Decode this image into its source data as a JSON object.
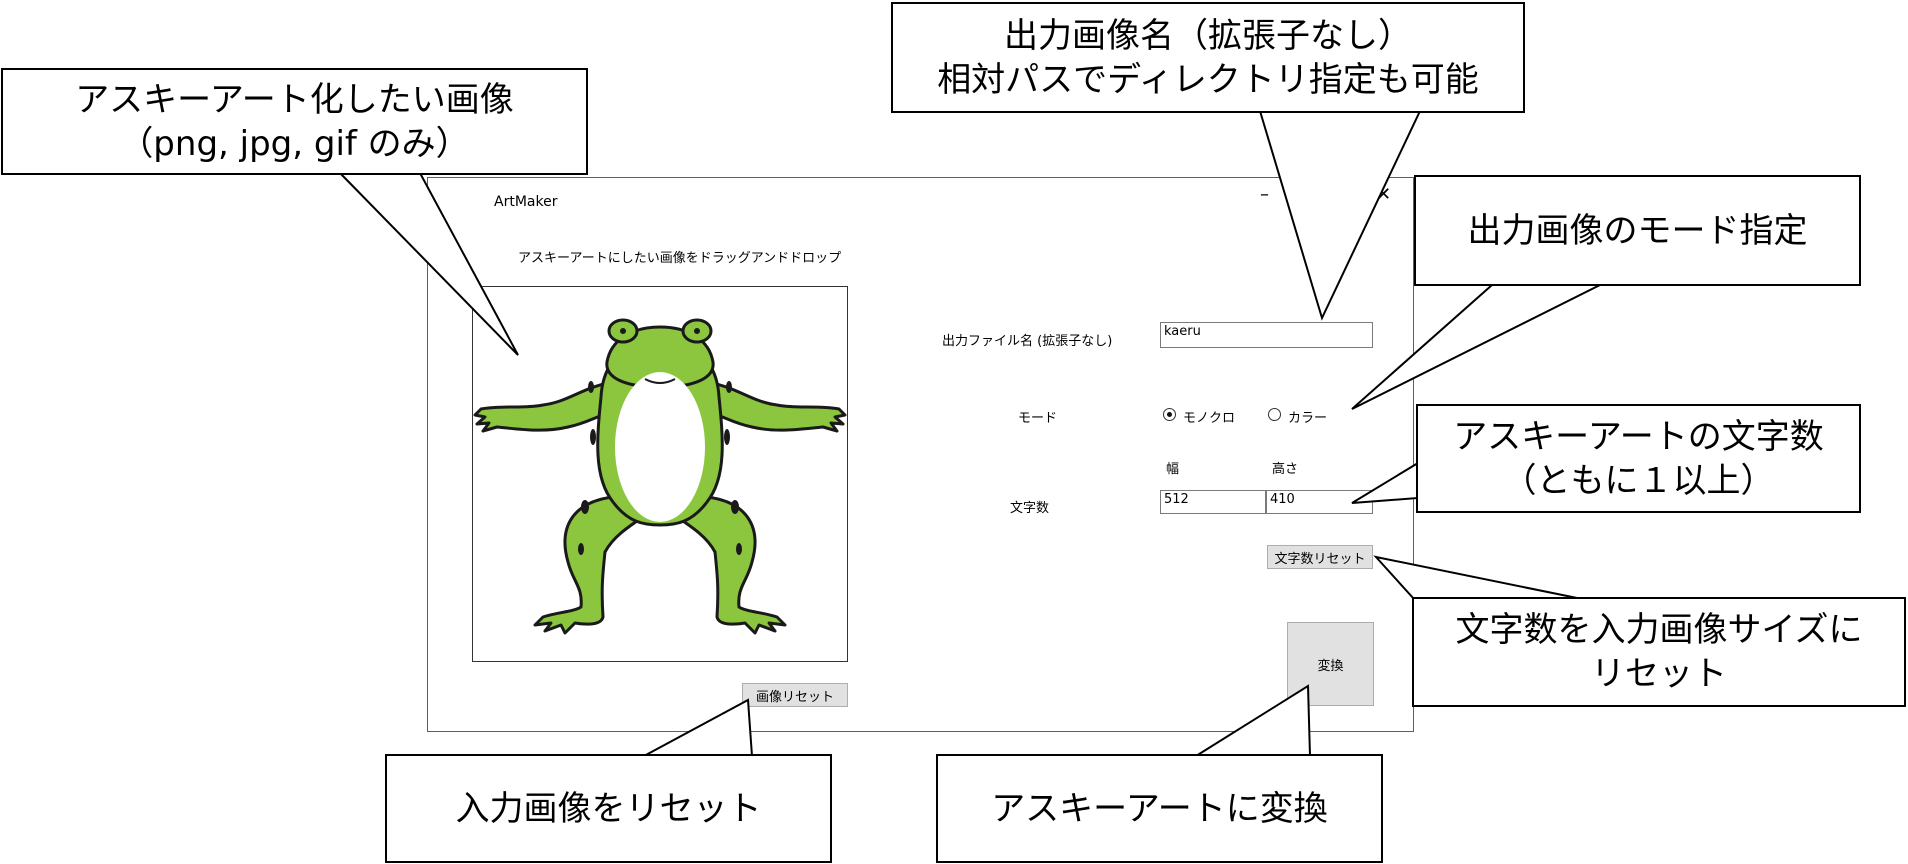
{
  "window": {
    "title": "ArtMaker",
    "minimize_glyph": "–",
    "close_glyph": "✕"
  },
  "dropzone": {
    "label": "アスキーアートにしたい画像をドラッグアンドドロップ"
  },
  "output": {
    "label": "出力ファイル名 (拡張子なし)",
    "value": "kaeru"
  },
  "mode": {
    "label": "モード",
    "options": [
      {
        "label": "モノクロ",
        "selected": true
      },
      {
        "label": "カラー",
        "selected": false
      }
    ]
  },
  "size": {
    "width_header": "幅",
    "height_header": "高さ",
    "label": "文字数",
    "width_value": "512",
    "height_value": "410",
    "reset_label": "文字数リセット"
  },
  "buttons": {
    "image_reset_label": "画像リセット",
    "convert_label": "変換"
  },
  "callouts": {
    "input_image": {
      "line1": "アスキーアート化したい画像",
      "line2": "（png, jpg, gif のみ）"
    },
    "output_name": {
      "line1": "出力画像名（拡張子なし）",
      "line2": "相対パスでディレクトリ指定も可能"
    },
    "mode": {
      "line1": "出力画像のモード指定"
    },
    "char_count": {
      "line1": "アスキーアートの文字数",
      "line2": "（ともに１以上）"
    },
    "char_reset": {
      "line1": "文字数を入力画像サイズに",
      "line2": "リセット"
    },
    "image_reset": {
      "line1": "入力画像をリセット"
    },
    "convert": {
      "line1": "アスキーアートに変換"
    }
  },
  "colors": {
    "window_border": "#1f6fb2",
    "frog_green": "#8cc63f",
    "frog_dark": "#1a1a1a",
    "button_face": "#e1e1e1"
  }
}
